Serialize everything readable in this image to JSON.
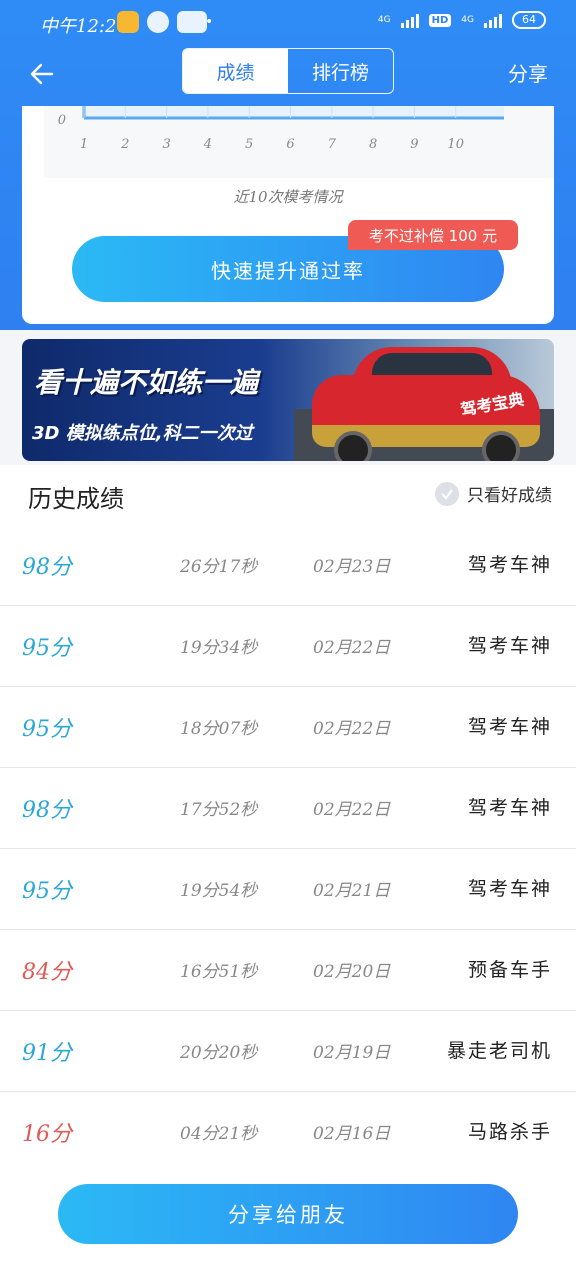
{
  "status_bar": {
    "time": "中午12:27",
    "net_label_1": "4G",
    "net_label_2": "4G",
    "hd": "HD",
    "battery": "64"
  },
  "nav": {
    "tabs": [
      {
        "label": "成绩",
        "active": true
      },
      {
        "label": "排行榜",
        "active": false
      }
    ],
    "share_label": "分享"
  },
  "chart_data": {
    "type": "line",
    "x": [
      1,
      2,
      3,
      4,
      5,
      6,
      7,
      8,
      9,
      10
    ],
    "y_visible_tick": "0",
    "caption": "近10次模考情况"
  },
  "score_card": {
    "boost_button": "快速提升通过率",
    "refund_badge": "考不过补偿 100 元"
  },
  "banner": {
    "title": "看十遍不如练一遍",
    "subtitle": "3D 模拟练点位,科二一次过",
    "car_label": "驾考宝典"
  },
  "history": {
    "title": "历史成绩",
    "filter_label": "只看好成绩",
    "records": [
      {
        "score": "98分",
        "duration": "26分17秒",
        "date": "02月23日",
        "rank_title": "驾考车神",
        "color": "#2aa7d6"
      },
      {
        "score": "95分",
        "duration": "19分34秒",
        "date": "02月22日",
        "rank_title": "驾考车神",
        "color": "#2aa7d6"
      },
      {
        "score": "95分",
        "duration": "18分07秒",
        "date": "02月22日",
        "rank_title": "驾考车神",
        "color": "#2aa7d6"
      },
      {
        "score": "98分",
        "duration": "17分52秒",
        "date": "02月22日",
        "rank_title": "驾考车神",
        "color": "#2aa7d6"
      },
      {
        "score": "95分",
        "duration": "19分54秒",
        "date": "02月21日",
        "rank_title": "驾考车神",
        "color": "#2aa7d6"
      },
      {
        "score": "84分",
        "duration": "16分51秒",
        "date": "02月20日",
        "rank_title": "预备车手",
        "color": "#e05a55"
      },
      {
        "score": "91分",
        "duration": "20分20秒",
        "date": "02月19日",
        "rank_title": "暴走老司机",
        "color": "#2aa7d6"
      },
      {
        "score": "16分",
        "duration": "04分21秒",
        "date": "02月16日",
        "rank_title": "马路杀手",
        "color": "#e05a55"
      }
    ]
  },
  "share_button": "分享给朋友"
}
